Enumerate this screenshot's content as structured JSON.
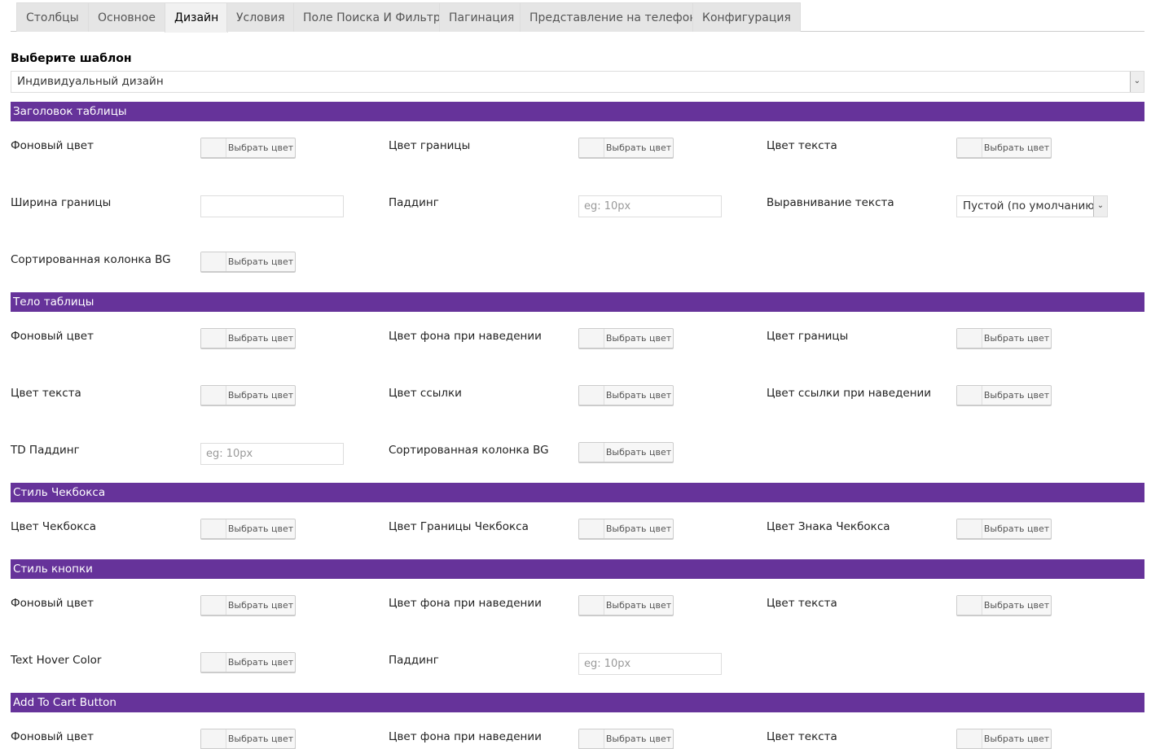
{
  "tabs": [
    "Столбцы",
    "Основное",
    "Дизайн",
    "Условия",
    "Поле Поиска И Фильтр",
    "Пагинация",
    "Представление на телефоне",
    "Конфигурация"
  ],
  "active_tab": 2,
  "template": {
    "label": "Выберите шаблон",
    "value": "Индивидуальный дизайн"
  },
  "color_button_label": "Выбрать цвет",
  "sections": [
    {
      "title": "Заголовок таблицы",
      "rows": [
        [
          {
            "label": "Фоновый цвет",
            "type": "color"
          },
          {
            "label": "Цвет границы",
            "type": "color"
          },
          {
            "label": "Цвет текста",
            "type": "color"
          }
        ],
        [
          {
            "label": "Ширина границы",
            "type": "input",
            "placeholder": ""
          },
          {
            "label": "Паддинг",
            "type": "input",
            "placeholder": "eg: 10px"
          },
          {
            "label": "Выравнивание текста",
            "type": "select",
            "value": "Пустой (по умолчанию)"
          }
        ],
        [
          {
            "label": "Сортированная колонка BG",
            "type": "color"
          }
        ]
      ]
    },
    {
      "title": "Тело таблицы",
      "rows": [
        [
          {
            "label": "Фоновый цвет",
            "type": "color"
          },
          {
            "label": "Цвет фона при наведении",
            "type": "color"
          },
          {
            "label": "Цвет границы",
            "type": "color"
          }
        ],
        [
          {
            "label": "Цвет текста",
            "type": "color"
          },
          {
            "label": "Цвет ссылки",
            "type": "color"
          },
          {
            "label": "Цвет ссылки при наведении",
            "type": "color"
          }
        ],
        [
          {
            "label": "TD Паддинг",
            "type": "input",
            "placeholder": "eg: 10px"
          },
          {
            "label": "Сортированная колонка BG",
            "type": "color"
          }
        ]
      ]
    },
    {
      "title": "Стиль Чекбокса",
      "rows": [
        [
          {
            "label": "Цвет Чекбокса",
            "type": "color"
          },
          {
            "label": "Цвет Границы Чекбокса",
            "type": "color"
          },
          {
            "label": "Цвет Знака Чекбокса",
            "type": "color"
          }
        ]
      ]
    },
    {
      "title": "Стиль кнопки",
      "rows": [
        [
          {
            "label": "Фоновый цвет",
            "type": "color"
          },
          {
            "label": "Цвет фона при наведении",
            "type": "color"
          },
          {
            "label": "Цвет текста",
            "type": "color"
          }
        ],
        [
          {
            "label": "Text Hover Color",
            "type": "color"
          },
          {
            "label": "Паддинг",
            "type": "input",
            "placeholder": "eg: 10px"
          }
        ]
      ]
    },
    {
      "title": "Add To Cart Button",
      "rows": [
        [
          {
            "label": "Фоновый цвет",
            "type": "color"
          },
          {
            "label": "Цвет фона при наведении",
            "type": "color"
          },
          {
            "label": "Цвет текста",
            "type": "color"
          }
        ]
      ]
    }
  ]
}
